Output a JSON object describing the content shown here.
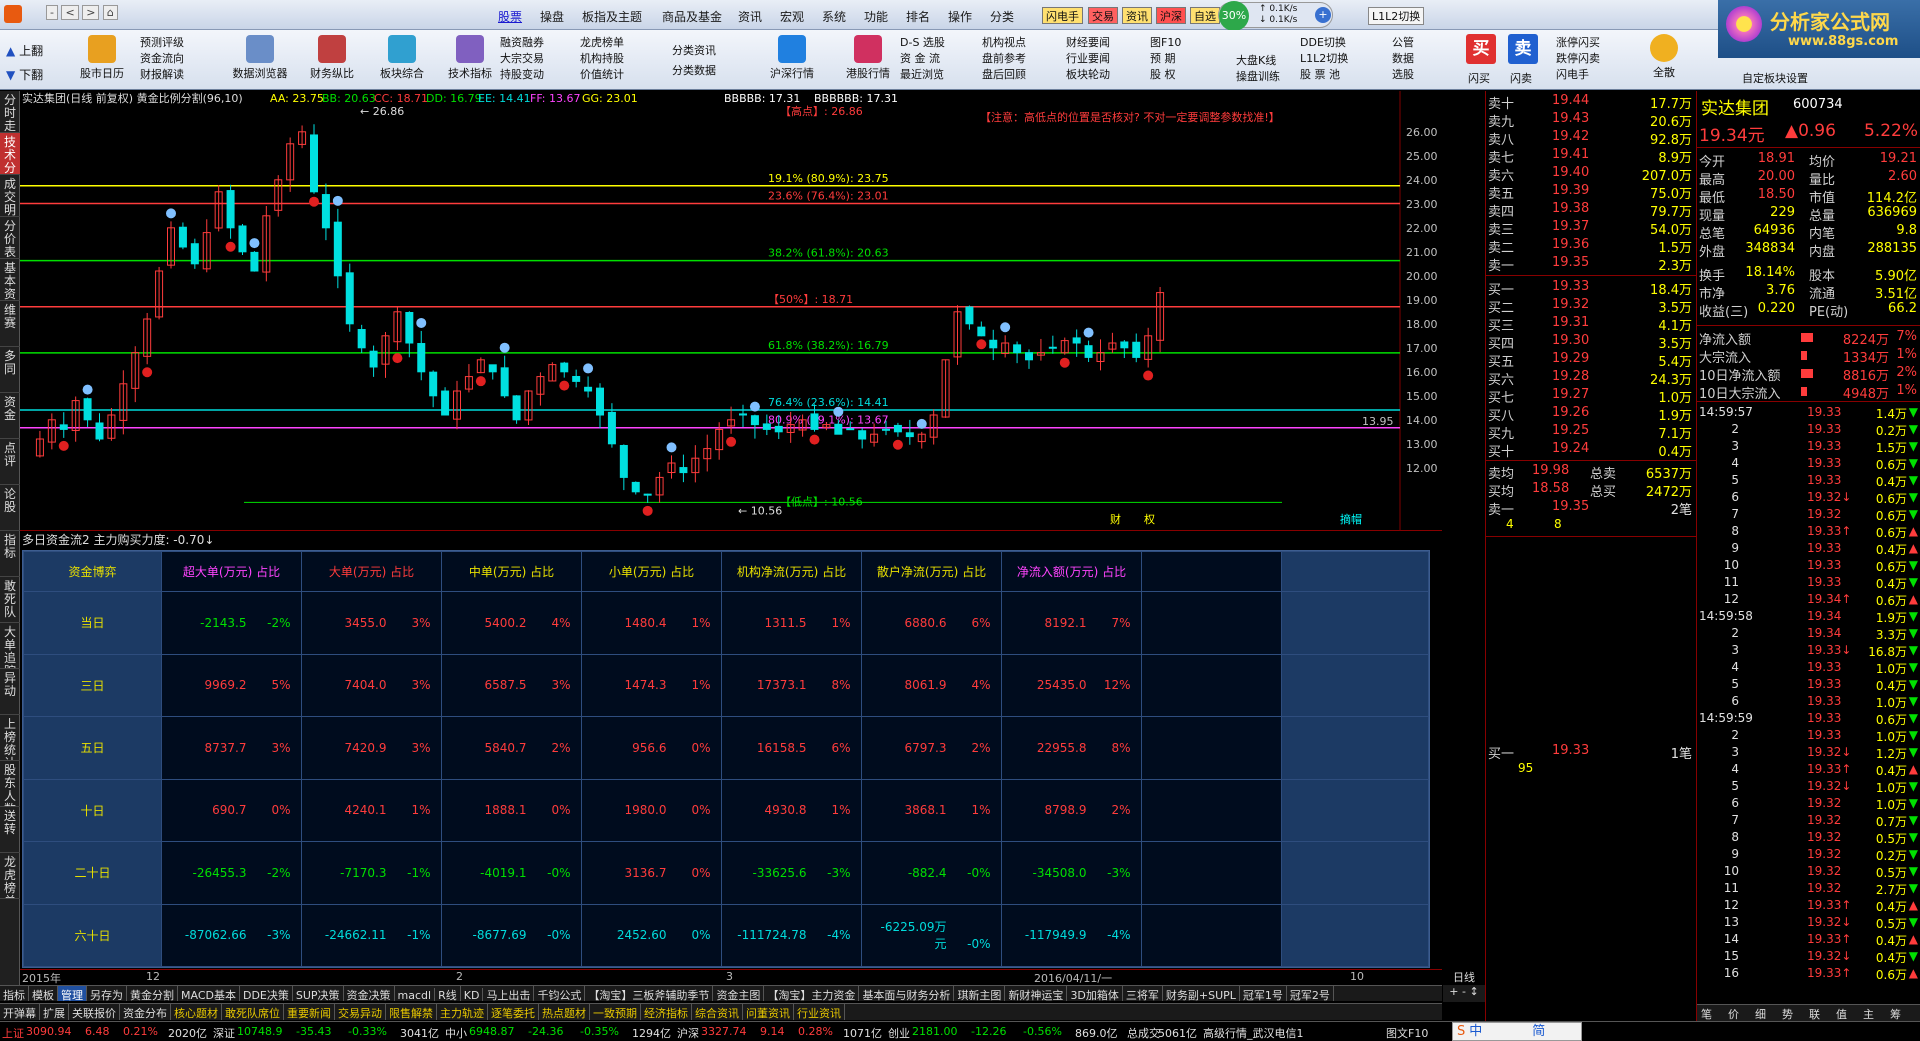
{
  "menu": {
    "items": [
      "股票",
      "操盘",
      "板指及主题",
      "商品及基金",
      "资讯",
      "宏观",
      "系统",
      "功能",
      "排名",
      "操作",
      "分类"
    ],
    "active": "股票",
    "tags": [
      "闪电手",
      "交易",
      "资讯",
      "沪深",
      "自选"
    ],
    "net_up": "0.1K/s",
    "net_down": "0.1K/s",
    "pct_circle": "30%",
    "right_tags": [
      "L1L2切换"
    ],
    "logo": "分析家公式网",
    "logo_url": "www.88gs.com"
  },
  "toolbar": {
    "nav": [
      "上翻",
      "下翻"
    ],
    "buttons": [
      "股市日历",
      "数据浏览器",
      "财务纵比",
      "板块综合",
      "技术指标",
      "沪深行情",
      "港股行情"
    ],
    "small1": [
      "预测评级",
      "资金流向",
      "财报解读"
    ],
    "small2": [
      "融资融券",
      "大宗交易",
      "持股变动"
    ],
    "small3": [
      "龙虎榜单",
      "机构持股",
      "价值统计"
    ],
    "small4": [
      "分类资讯",
      "分类数据"
    ],
    "small5": [
      "D-S 选股",
      "资 金 流",
      "最近浏览"
    ],
    "small6": [
      "机构视点",
      "盘前参考",
      "盘后回顾"
    ],
    "small7": [
      "财经要闻",
      "行业要闻",
      "板块轮动"
    ],
    "small8": [
      "图F10",
      "预 期",
      "股 权"
    ],
    "small9": [
      "大盘K线",
      "操盘训练"
    ],
    "small10": [
      "DDE切换",
      "L1L2切换",
      "股 票 池"
    ],
    "small11": [
      "公管",
      "数据",
      "选股"
    ],
    "buy": "买",
    "sell": "卖",
    "flash_buy": "闪买",
    "flash_sell": "闪卖",
    "small12": [
      "涨停闪买",
      "跌停闪卖",
      "闪电手"
    ],
    "full": "全散",
    "custom": "自定板块设置"
  },
  "left_tabs": [
    "分时走势",
    "技术分析",
    "成交明细",
    "分价表",
    "基本资料",
    "维赛",
    "多同",
    "资金",
    "点评",
    "论股",
    "指标",
    "敢死队",
    "大单追踪",
    "异动",
    "上榜统计",
    "股东人数",
    "送转",
    "龙虎榜单"
  ],
  "chart": {
    "header": "实达集团(日线 前复权) 黄金比例分割(96,10)",
    "indicators": [
      {
        "label": "AA: 23.75",
        "color": "#ffff00"
      },
      {
        "label": "BB: 20.63",
        "color": "#00e000"
      },
      {
        "label": "CC: 18.71",
        "color": "#ff3c3c"
      },
      {
        "label": "DD: 16.79",
        "color": "#00e000"
      },
      {
        "label": "EE: 14.41",
        "color": "#00dcdc"
      },
      {
        "label": "FF: 13.67",
        "color": "#ff44ff"
      },
      {
        "label": "GG: 23.01",
        "color": "#ffff00"
      },
      {
        "label": "BBBBB: 17.31",
        "color": "#ffffff"
      },
      {
        "label": "BBBBBB: 17.31",
        "color": "#ffffff"
      }
    ],
    "warning": "【注意：高低点的位置是否核对? 不对一定要调整参数找准!】",
    "high_label": "【高点】: 26.86",
    "low_label": "【低点】: 10.56",
    "fib": [
      {
        "label": "19.1% (80.9%): 23.75",
        "value": 23.75,
        "color": "#ffff00"
      },
      {
        "label": "23.6% (76.4%): 23.01",
        "value": 23.01,
        "color": "#ff3c3c"
      },
      {
        "label": "38.2% (61.8%): 20.63",
        "value": 20.63,
        "color": "#00e000"
      },
      {
        "label": "【50%】: 18.71",
        "value": 18.71,
        "color": "#ff3c3c"
      },
      {
        "label": "61.8% (38.2%): 16.79",
        "value": 16.79,
        "color": "#00e000"
      },
      {
        "label": "76.4% (23.6%): 14.41",
        "value": 14.41,
        "color": "#00dcdc"
      },
      {
        "label": "80.9% (19.1%): 13.67",
        "value": 13.67,
        "color": "#ff44ff"
      }
    ],
    "price_axis": [
      "26.00",
      "25.00",
      "24.00",
      "23.00",
      "22.00",
      "21.00",
      "20.00",
      "19.00",
      "18.00",
      "17.00",
      "16.00",
      "15.00",
      "14.00",
      "13.95",
      "13.00",
      "12.00"
    ],
    "markers": [
      "财",
      "权",
      "摘帽"
    ],
    "peak": "26.86",
    "trough": "10.56",
    "current_price_tag": "13.95"
  },
  "indicator_line": "多日资金流2 主力购买力度: -0.70↓",
  "fund_table": {
    "headers": [
      "资金博弈",
      "超大单(万元) 占比",
      "大单(万元) 占比",
      "中单(万元) 占比",
      "小单(万元) 占比",
      "机构净流(万元) 占比",
      "散户净流(万元) 占比",
      "净流入额(万元) 占比"
    ],
    "header_colors": [
      "#e8e000",
      "#ff44ff",
      "#ff3c3c",
      "#e8e000",
      "#e8e000",
      "#e8e000",
      "#e8e000",
      "#ff44ff"
    ],
    "rows": [
      {
        "label": "当日",
        "cells": [
          [
            "-2143.5",
            "-2%",
            "g"
          ],
          [
            "3455.0",
            "3%",
            "r"
          ],
          [
            "5400.2",
            "4%",
            "r"
          ],
          [
            "1480.4",
            "1%",
            "r"
          ],
          [
            "1311.5",
            "1%",
            "r"
          ],
          [
            "6880.6",
            "6%",
            "r"
          ],
          [
            "8192.1",
            "7%",
            "r"
          ]
        ]
      },
      {
        "label": "三日",
        "cells": [
          [
            "9969.2",
            "5%",
            "r"
          ],
          [
            "7404.0",
            "3%",
            "r"
          ],
          [
            "6587.5",
            "3%",
            "r"
          ],
          [
            "1474.3",
            "1%",
            "r"
          ],
          [
            "17373.1",
            "8%",
            "r"
          ],
          [
            "8061.9",
            "4%",
            "r"
          ],
          [
            "25435.0",
            "12%",
            "r"
          ]
        ]
      },
      {
        "label": "五日",
        "cells": [
          [
            "8737.7",
            "3%",
            "r"
          ],
          [
            "7420.9",
            "3%",
            "r"
          ],
          [
            "5840.7",
            "2%",
            "r"
          ],
          [
            "956.6",
            "0%",
            "r"
          ],
          [
            "16158.5",
            "6%",
            "r"
          ],
          [
            "6797.3",
            "2%",
            "r"
          ],
          [
            "22955.8",
            "8%",
            "r"
          ]
        ]
      },
      {
        "label": "十日",
        "cells": [
          [
            "690.7",
            "0%",
            "r"
          ],
          [
            "4240.1",
            "1%",
            "r"
          ],
          [
            "1888.1",
            "0%",
            "r"
          ],
          [
            "1980.0",
            "0%",
            "r"
          ],
          [
            "4930.8",
            "1%",
            "r"
          ],
          [
            "3868.1",
            "1%",
            "r"
          ],
          [
            "8798.9",
            "2%",
            "r"
          ]
        ]
      },
      {
        "label": "二十日",
        "cells": [
          [
            "-26455.3",
            "-2%",
            "g"
          ],
          [
            "-7170.3",
            "-1%",
            "g"
          ],
          [
            "-4019.1",
            "-0%",
            "g"
          ],
          [
            "3136.7",
            "0%",
            "r"
          ],
          [
            "-33625.6",
            "-3%",
            "g"
          ],
          [
            "-882.4",
            "-0%",
            "g"
          ],
          [
            "-34508.0",
            "-3%",
            "g"
          ]
        ]
      },
      {
        "label": "六十日",
        "cells": [
          [
            "-87062.66",
            "-3%",
            "c"
          ],
          [
            "-24662.11",
            "-1%",
            "c"
          ],
          [
            "-8677.69",
            "-0%",
            "c"
          ],
          [
            "2452.60",
            "0%",
            "c"
          ],
          [
            "-111724.78",
            "-4%",
            "c"
          ],
          [
            "-6225.09万元",
            "-0%",
            "c"
          ],
          [
            "-117949.9",
            "-4%",
            "c"
          ]
        ]
      }
    ]
  },
  "axis_dates": [
    "2015年",
    "12",
    "2",
    "3",
    "2016/04/11/一",
    "4",
    "10"
  ],
  "period": "日线",
  "tabs_row1": [
    "指标",
    "模板",
    "管理",
    "另存为",
    "黄金分割",
    "MACD基本",
    "DDE决策",
    "SUP决策",
    "资金决策",
    "macdl",
    "R线",
    "KD",
    "马上出击",
    "千钧公式",
    "【淘宝】三板斧辅助季节",
    "资金主图",
    "【淘宝】主力资金",
    "基本面与财务分析",
    "琪新主图",
    "新财神运宝",
    "3D加箱体",
    "三将军",
    "财务副+SUPL",
    "冠军1号",
    "冠军2号"
  ],
  "tabs_row2": [
    "开弹幕",
    "扩展",
    "关联报价",
    "资金分布",
    "核心题材",
    "敢死队席位",
    "重要新闻",
    "交易异动",
    "限售解禁",
    "主力轨迹",
    "逐笔委托",
    "热点题材",
    "一致预期",
    "经济指标",
    "综合资讯",
    "问董资讯",
    "行业资讯"
  ],
  "quote": {
    "sell_levels": [
      {
        "label": "卖十",
        "price": "19.44",
        "vol": "17.7万"
      },
      {
        "label": "卖九",
        "price": "19.43",
        "vol": "20.6万"
      },
      {
        "label": "卖八",
        "price": "19.42",
        "vol": "92.8万"
      },
      {
        "label": "卖七",
        "price": "19.41",
        "vol": "8.9万"
      },
      {
        "label": "卖六",
        "price": "19.40",
        "vol": "207.0万"
      },
      {
        "label": "卖五",
        "price": "19.39",
        "vol": "75.0万"
      },
      {
        "label": "卖四",
        "price": "19.38",
        "vol": "79.7万"
      },
      {
        "label": "卖三",
        "price": "19.37",
        "vol": "54.0万"
      },
      {
        "label": "卖二",
        "price": "19.36",
        "vol": "1.5万"
      },
      {
        "label": "卖一",
        "price": "19.35",
        "vol": "2.3万"
      }
    ],
    "buy_levels": [
      {
        "label": "买一",
        "price": "19.33",
        "vol": "18.4万"
      },
      {
        "label": "买二",
        "price": "19.32",
        "vol": "3.5万"
      },
      {
        "label": "买三",
        "price": "19.31",
        "vol": "4.1万"
      },
      {
        "label": "买四",
        "price": "19.30",
        "vol": "3.5万"
      },
      {
        "label": "买五",
        "price": "19.29",
        "vol": "5.4万"
      },
      {
        "label": "买六",
        "price": "19.28",
        "vol": "24.3万"
      },
      {
        "label": "买七",
        "price": "19.27",
        "vol": "1.0万"
      },
      {
        "label": "买八",
        "price": "19.26",
        "vol": "1.9万"
      },
      {
        "label": "买九",
        "price": "19.25",
        "vol": "7.1万"
      },
      {
        "label": "买十",
        "price": "19.24",
        "vol": "0.4万"
      }
    ],
    "avg_sell": {
      "label": "卖均",
      "price": "19.98",
      "total_label": "总卖",
      "total": "6537万"
    },
    "avg_buy": {
      "label": "买均",
      "price": "18.58",
      "total_label": "总买",
      "total": "2472万"
    },
    "sell1_queue": {
      "label": "卖一",
      "price": "19.35",
      "vol": "2笔",
      "q": [
        "4",
        "8"
      ]
    },
    "buy1_queue": {
      "label": "买一",
      "price": "19.33",
      "vol": "1笔",
      "q": [
        "95"
      ]
    }
  },
  "stock": {
    "name": "实达集团",
    "code": "600734",
    "price": "19.34元",
    "change": "▲0.96",
    "pct": "5.22%",
    "stats": [
      [
        "今开",
        "18.91",
        "均价",
        "19.21"
      ],
      [
        "最高",
        "20.00",
        "量比",
        "2.60"
      ],
      [
        "最低",
        "18.50",
        "市值",
        "114.2亿"
      ],
      [
        "现量",
        "229",
        "总量",
        "636969"
      ],
      [
        "总笔",
        "64936",
        "内笔",
        "9.8"
      ],
      [
        "外盘",
        "348834",
        "内盘",
        "288135"
      ],
      [
        "换手",
        "18.14%",
        "股本",
        "5.90亿"
      ],
      [
        "市净",
        "3.76",
        "流通",
        "3.51亿"
      ],
      [
        "收益(三)",
        "0.220",
        "PE(动)",
        "66.2"
      ]
    ],
    "flows": [
      [
        "净流入额",
        "8224万",
        "7%"
      ],
      [
        "大宗流入",
        "1334万",
        "1%"
      ],
      [
        "10日净流入额",
        "8816万",
        "2%"
      ],
      [
        "10日大宗流入",
        "4948万",
        "1%"
      ]
    ]
  },
  "ticks": {
    "time1": "14:59:57",
    "time2": "14:59:58",
    "time3": "14:59:59",
    "rows": [
      [
        "",
        "19.33",
        "1.4万",
        "g"
      ],
      [
        "2",
        "19.33",
        "0.2万",
        "g"
      ],
      [
        "3",
        "19.33",
        "1.5万",
        "g"
      ],
      [
        "4",
        "19.33",
        "0.6万",
        "g"
      ],
      [
        "5",
        "19.33",
        "0.4万",
        "g"
      ],
      [
        "6",
        "19.32↓",
        "0.6万",
        "g"
      ],
      [
        "7",
        "19.32",
        "0.6万",
        "g"
      ],
      [
        "8",
        "19.33↑",
        "0.6万",
        "r"
      ],
      [
        "9",
        "19.33",
        "0.4万",
        "r"
      ],
      [
        "10",
        "19.33",
        "0.6万",
        "g"
      ],
      [
        "11",
        "19.33",
        "0.4万",
        "g"
      ],
      [
        "12",
        "19.34↑",
        "0.6万",
        "r"
      ],
      [
        "",
        "19.34",
        "1.9万",
        "g"
      ],
      [
        "2",
        "19.34",
        "3.3万",
        "g"
      ],
      [
        "3",
        "19.33↓",
        "16.8万",
        "g"
      ],
      [
        "4",
        "19.33",
        "1.0万",
        "g"
      ],
      [
        "5",
        "19.33",
        "0.4万",
        "g"
      ],
      [
        "6",
        "19.33",
        "1.0万",
        "g"
      ],
      [
        "",
        "19.33",
        "0.6万",
        "g"
      ],
      [
        "2",
        "19.33",
        "1.0万",
        "g"
      ],
      [
        "3",
        "19.32↓",
        "1.2万",
        "g"
      ],
      [
        "4",
        "19.33↑",
        "0.4万",
        "r"
      ],
      [
        "5",
        "19.32↓",
        "1.0万",
        "g"
      ],
      [
        "6",
        "19.32",
        "1.0万",
        "g"
      ],
      [
        "7",
        "19.32",
        "0.7万",
        "g"
      ],
      [
        "8",
        "19.32",
        "0.5万",
        "g"
      ],
      [
        "9",
        "19.32",
        "0.2万",
        "g"
      ],
      [
        "10",
        "19.32",
        "0.5万",
        "g"
      ],
      [
        "11",
        "19.32",
        "2.7万",
        "g"
      ],
      [
        "12",
        "19.33↑",
        "0.4万",
        "r"
      ],
      [
        "13",
        "19.32↓",
        "0.5万",
        "g"
      ],
      [
        "14",
        "19.33↑",
        "0.4万",
        "r"
      ],
      [
        "15",
        "19.32↓",
        "0.4万",
        "g"
      ],
      [
        "16",
        "19.33↑",
        "0.6万",
        "r"
      ]
    ]
  },
  "right_tabs": [
    "笔",
    "价",
    "细",
    "势",
    "联",
    "值",
    "主",
    "筹"
  ],
  "status": {
    "items": [
      {
        "t": "上证",
        "c": "#ff3c3c"
      },
      {
        "t": "3090.94",
        "c": "#ff3c3c"
      },
      {
        "t": "6.48",
        "c": "#ff3c3c"
      },
      {
        "t": "0.21%",
        "c": "#ff3c3c"
      },
      {
        "t": "2020亿",
        "c": "#e0e0e0"
      },
      {
        "t": "深证",
        "c": "#e0e0e0"
      },
      {
        "t": "10748.9",
        "c": "#00e000"
      },
      {
        "t": "-35.43",
        "c": "#00e000"
      },
      {
        "t": "-0.33%",
        "c": "#00e000"
      },
      {
        "t": "3041亿",
        "c": "#e0e0e0"
      },
      {
        "t": "中小",
        "c": "#e0e0e0"
      },
      {
        "t": "6948.87",
        "c": "#00e000"
      },
      {
        "t": "-24.36",
        "c": "#00e000"
      },
      {
        "t": "-0.35%",
        "c": "#00e000"
      },
      {
        "t": "1294亿",
        "c": "#e0e0e0"
      },
      {
        "t": "沪深",
        "c": "#e0e0e0"
      },
      {
        "t": "3327.74",
        "c": "#ff3c3c"
      },
      {
        "t": "9.14",
        "c": "#ff3c3c"
      },
      {
        "t": "0.28%",
        "c": "#ff3c3c"
      },
      {
        "t": "1071亿",
        "c": "#e0e0e0"
      },
      {
        "t": "创业",
        "c": "#e0e0e0"
      },
      {
        "t": "2181.00",
        "c": "#00e000"
      },
      {
        "t": "-12.26",
        "c": "#00e000"
      },
      {
        "t": "-0.56%",
        "c": "#00e000"
      },
      {
        "t": "869.0亿",
        "c": "#e0e0e0"
      },
      {
        "t": "总成交",
        "c": "#e0e0e0"
      },
      {
        "t": "5061亿",
        "c": "#e0e0e0"
      },
      {
        "t": "高级行情_武汉电信1",
        "c": "#e0e0e0"
      }
    ],
    "f10": "图文F10",
    "ime": "中",
    "jian": "简"
  },
  "colors": {
    "up": "#ff3c3c",
    "down": "#00e000",
    "header_bg": "#1c3a64",
    "accent_blue": "#1a1ad0"
  }
}
